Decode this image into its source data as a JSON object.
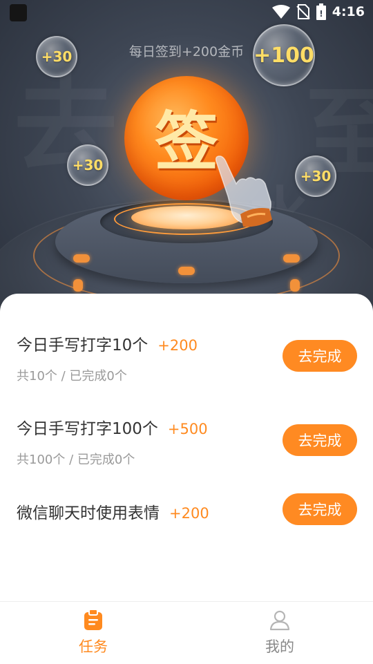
{
  "status_bar": {
    "time": "4:16"
  },
  "hero": {
    "daily_signin_text": "每日签到+200金币",
    "sign_button_label": "签",
    "bubbles": [
      "+30",
      "+100",
      "+30",
      "+30"
    ]
  },
  "tasks": [
    {
      "title": "今日手写打字10个",
      "reward": "+200",
      "progress": "共10个 / 已完成0个",
      "button": "去完成"
    },
    {
      "title": "今日手写打字100个",
      "reward": "+500",
      "progress": "共100个 / 已完成0个",
      "button": "去完成"
    },
    {
      "title": "微信聊天时使用表情",
      "reward": "+200",
      "button": "去完成"
    }
  ],
  "bottom_nav": {
    "items": [
      {
        "label": "任务",
        "icon": "clipboard-icon",
        "active": true
      },
      {
        "label": "我的",
        "icon": "user-icon",
        "active": false
      }
    ],
    "active_color": "#ff8a1f",
    "inactive_color": "#888888"
  },
  "colors": {
    "accent": "#ff8a1f",
    "hero_bg": "#3e4654"
  }
}
